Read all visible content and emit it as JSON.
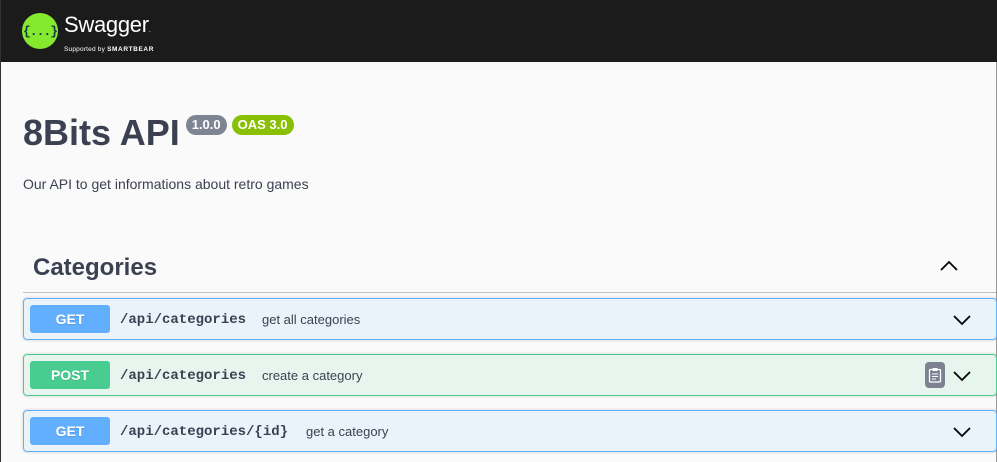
{
  "topbar": {
    "logo_glyph": "{...}",
    "brand_name": "Swagger",
    "brand_dot": ".",
    "supported_by_prefix": "Supported by ",
    "supported_by_company": "SMARTBEAR"
  },
  "info": {
    "title": "8Bits API",
    "version": "1.0.0",
    "oas_version": "OAS 3.0",
    "description": "Our API to get informations about retro games"
  },
  "tag": {
    "name": "Categories",
    "expanded": true
  },
  "operations": [
    {
      "method": "GET",
      "path": "/api/categories",
      "summary": "get all categories"
    },
    {
      "method": "POST",
      "path": "/api/categories",
      "summary": "create a category"
    },
    {
      "method": "GET",
      "path": "/api/categories/{id}",
      "summary": "get a category"
    }
  ],
  "colors": {
    "get": "#61affe",
    "post": "#49cc90",
    "topbar": "#1b1b1b",
    "logo": "#85ea2d",
    "version_badge": "#7d8492",
    "oas_badge": "#89bf04"
  }
}
